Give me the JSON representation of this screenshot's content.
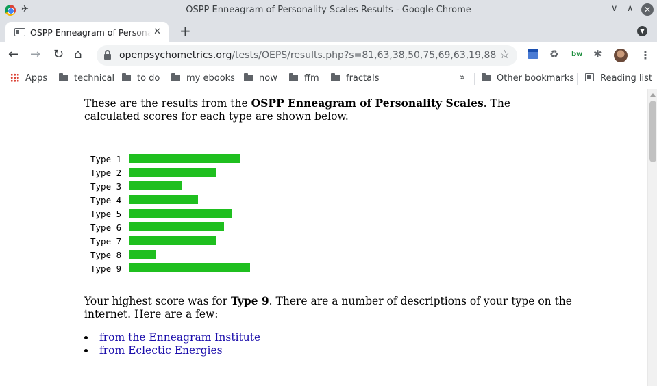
{
  "window": {
    "title": "OSPP Enneagram of Personality Scales Results - Google Chrome"
  },
  "tab": {
    "title": "OSPP Enneagram of Personality Scales Results"
  },
  "toolbar": {
    "url_host": "openpsychometrics.org",
    "url_path": "/tests/OEPS/results.php?s=81,63,38,50,75,69,63,19,88",
    "ext_bw_label": "bw"
  },
  "bookmarks": {
    "items": [
      {
        "label": "Apps"
      },
      {
        "label": "technical"
      },
      {
        "label": "to do"
      },
      {
        "label": "my ebooks"
      },
      {
        "label": "now"
      },
      {
        "label": "ffm"
      },
      {
        "label": "fractals"
      }
    ],
    "more": "»",
    "other": "Other bookmarks",
    "reading_list": "Reading list"
  },
  "page": {
    "intro_prefix": "These are the results from the ",
    "intro_bold": "OSPP Enneagram of Personality Scales",
    "intro_suffix": ". The calculated scores for each type are shown below.",
    "highest_prefix": "Your highest score was for ",
    "highest_bold": "Type 9",
    "highest_suffix": ". There are a number of descriptions of your type on the internet. Here are a few:",
    "links": [
      {
        "label": "from the Enneagram Institute"
      },
      {
        "label": "from Eclectic Energies"
      }
    ]
  },
  "chart_data": {
    "type": "bar",
    "orientation": "horizontal",
    "categories": [
      "Type 1",
      "Type 2",
      "Type 3",
      "Type 4",
      "Type 5",
      "Type 6",
      "Type 7",
      "Type 8",
      "Type 9"
    ],
    "values": [
      81,
      63,
      38,
      50,
      75,
      69,
      63,
      19,
      88
    ],
    "xlim": [
      0,
      100
    ],
    "bar_color": "#1fbf1f",
    "title": "",
    "xlabel": "",
    "ylabel": ""
  }
}
